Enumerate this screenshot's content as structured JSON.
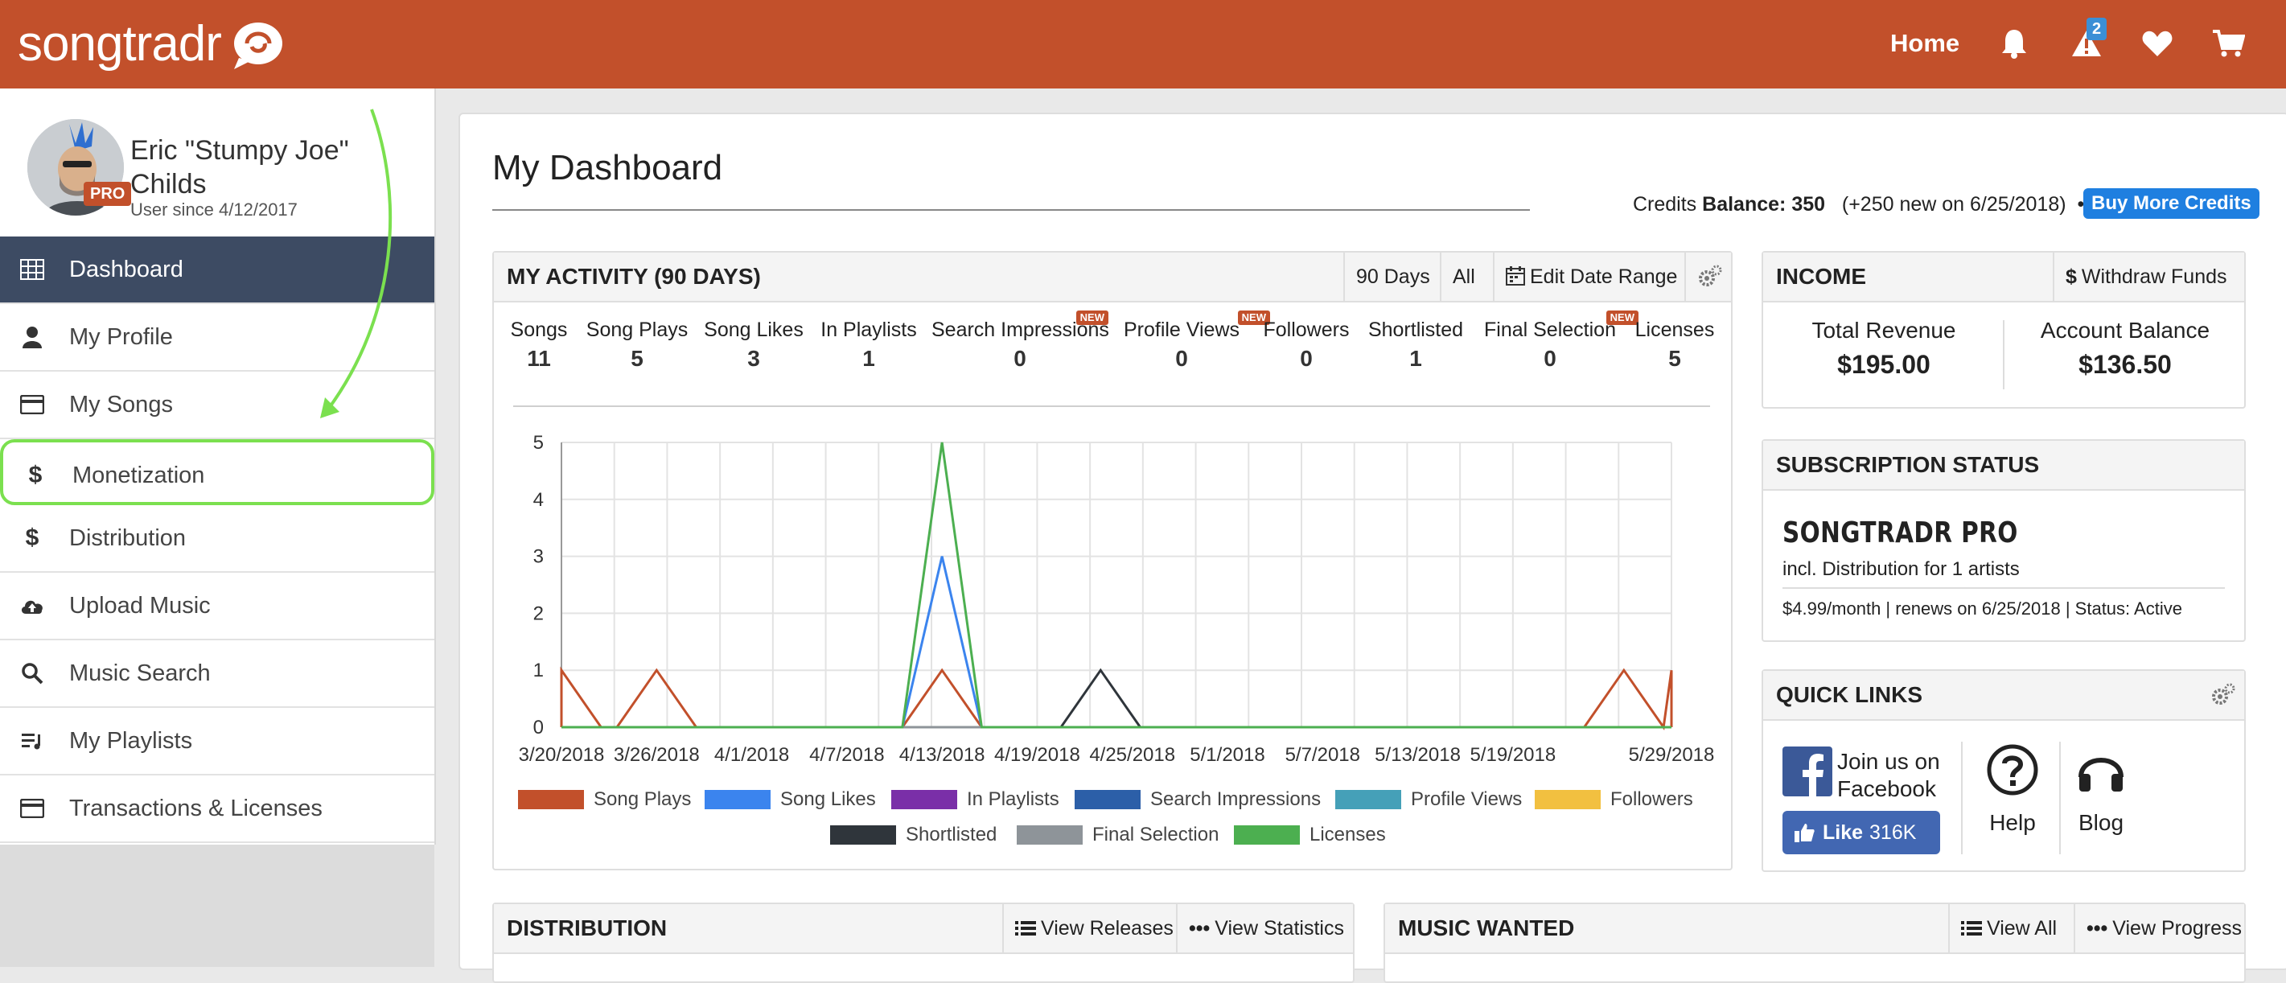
{
  "header": {
    "logo_text": "songtradr",
    "nav_home": "Home",
    "alert_count": "2"
  },
  "user": {
    "name": "Eric \"Stumpy Joe\" Childs",
    "badge": "PRO",
    "since": "User since 4/12/2017"
  },
  "sidebar": {
    "items": [
      {
        "label": "Dashboard",
        "icon": "grid-icon"
      },
      {
        "label": "My Profile",
        "icon": "user-icon"
      },
      {
        "label": "My Songs",
        "icon": "card-icon"
      },
      {
        "label": "Monetization",
        "icon": "dollar-icon"
      },
      {
        "label": "Distribution",
        "icon": "dollar-icon"
      },
      {
        "label": "Upload Music",
        "icon": "cloud-upload-icon"
      },
      {
        "label": "Music Search",
        "icon": "search-icon"
      },
      {
        "label": "My Playlists",
        "icon": "playlist-icon"
      },
      {
        "label": "Transactions & Licenses",
        "icon": "card-icon"
      }
    ]
  },
  "main": {
    "title": "My Dashboard",
    "credits_label": "Credits",
    "credits_balance_label": "Balance:",
    "credits_balance": "350",
    "credits_note": "(+250 new on 6/25/2018)",
    "credits_dot": "•",
    "buy_button": "Buy More Credits"
  },
  "activity": {
    "title": "MY ACTIVITY (90 DAYS)",
    "btn_90": "90 Days",
    "btn_all": "All",
    "btn_edit": "Edit Date Range",
    "stats": [
      {
        "label": "Songs",
        "value": "11",
        "new": ""
      },
      {
        "label": "Song Plays",
        "value": "5",
        "new": ""
      },
      {
        "label": "Song Likes",
        "value": "3",
        "new": ""
      },
      {
        "label": "In Playlists",
        "value": "1",
        "new": ""
      },
      {
        "label": "Search Impressions",
        "value": "0",
        "new": "NEW"
      },
      {
        "label": "Profile Views",
        "value": "0",
        "new": "NEW"
      },
      {
        "label": "Followers",
        "value": "0",
        "new": ""
      },
      {
        "label": "Shortlisted",
        "value": "1",
        "new": ""
      },
      {
        "label": "Final Selection",
        "value": "0",
        "new": "NEW"
      },
      {
        "label": "Licenses",
        "value": "5",
        "new": ""
      }
    ]
  },
  "chart_data": {
    "type": "line",
    "x_ticks": [
      "3/20/2018",
      "3/26/2018",
      "4/1/2018",
      "4/7/2018",
      "4/13/2018",
      "4/19/2018",
      "4/25/2018",
      "5/1/2018",
      "5/7/2018",
      "5/13/2018",
      "5/19/2018",
      "5/29/2018"
    ],
    "ylim": [
      0,
      5
    ],
    "y_ticks": [
      0,
      1,
      2,
      3,
      4,
      5
    ],
    "grid": true,
    "legend_position": "bottom",
    "series": [
      {
        "name": "Song Plays",
        "color": "#c2502b",
        "peaks": [
          [
            "3/20/2018",
            1
          ],
          [
            "3/26/2018",
            1
          ],
          [
            "4/13/2018",
            1
          ],
          [
            "5/26/2018",
            1
          ],
          [
            "5/29/2018",
            1
          ]
        ]
      },
      {
        "name": "Song Likes",
        "color": "#3b84ee",
        "peaks": [
          [
            "4/13/2018",
            3
          ]
        ]
      },
      {
        "name": "In Playlists",
        "color": "#7a2fa8",
        "peaks": []
      },
      {
        "name": "Search Impressions",
        "color": "#2c5fa8",
        "peaks": []
      },
      {
        "name": "Profile Views",
        "color": "#45a0b8",
        "peaks": []
      },
      {
        "name": "Followers",
        "color": "#f2c040",
        "peaks": []
      },
      {
        "name": "Shortlisted",
        "color": "#2f353b",
        "peaks": [
          [
            "4/23/2018",
            1
          ]
        ]
      },
      {
        "name": "Final Selection",
        "color": "#8e9499",
        "peaks": []
      },
      {
        "name": "Licenses",
        "color": "#4caf50",
        "peaks": [
          [
            "4/13/2018",
            5
          ]
        ]
      }
    ]
  },
  "income": {
    "title": "INCOME",
    "withdraw": "Withdraw Funds",
    "total_label": "Total Revenue",
    "total_value": "$195.00",
    "balance_label": "Account Balance",
    "balance_value": "$136.50"
  },
  "subscription": {
    "title": "SUBSCRIPTION STATUS",
    "plan": "SONGTRADR PRO",
    "line1": "incl. Distribution for 1 artists",
    "line2": "$4.99/month | renews on 6/25/2018 | Status: Active"
  },
  "quick_links": {
    "title": "QUICK LINKS",
    "fb_text": "Join us on Facebook",
    "fb_like": "Like",
    "fb_count": "316K",
    "help": "Help",
    "blog": "Blog"
  },
  "distribution": {
    "title": "DISTRIBUTION",
    "view_releases": "View Releases",
    "view_statistics": "View Statistics"
  },
  "music_wanted": {
    "title": "MUSIC WANTED",
    "view_all": "View All",
    "view_progress": "View Progress"
  },
  "colors": {
    "brand": "#c2502b",
    "sidebar_active": "#3d4b63",
    "highlight": "#7be04f",
    "button_blue": "#1f7fe0"
  }
}
